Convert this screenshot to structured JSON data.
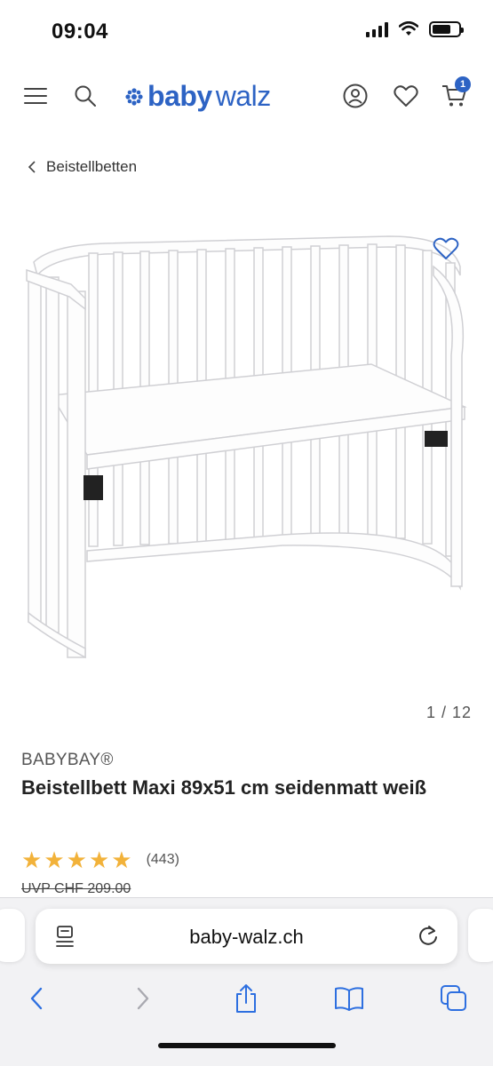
{
  "status_bar": {
    "time": "09:04"
  },
  "header": {
    "logo_left": "baby",
    "logo_right": "walz",
    "cart_count": "1",
    "icons": [
      "menu-icon",
      "search-icon",
      "account-icon",
      "wishlist-icon",
      "cart-icon"
    ]
  },
  "breadcrumb": {
    "label": "Beistellbetten"
  },
  "product": {
    "image_counter": "1 / 12",
    "brand": "BABYBAY®",
    "title": "Beistellbett Maxi 89x51 cm seidenmatt weiß",
    "rating_stars": 5,
    "rating_count": "(443)",
    "uvp": "UVP CHF 209.00"
  },
  "browser": {
    "url": "baby-walz.ch",
    "toolbar": [
      "back-icon",
      "forward-icon",
      "share-icon",
      "bookmarks-icon",
      "tabs-icon"
    ]
  },
  "colors": {
    "brand_blue": "#2d63c4",
    "star": "#f2b23a"
  }
}
